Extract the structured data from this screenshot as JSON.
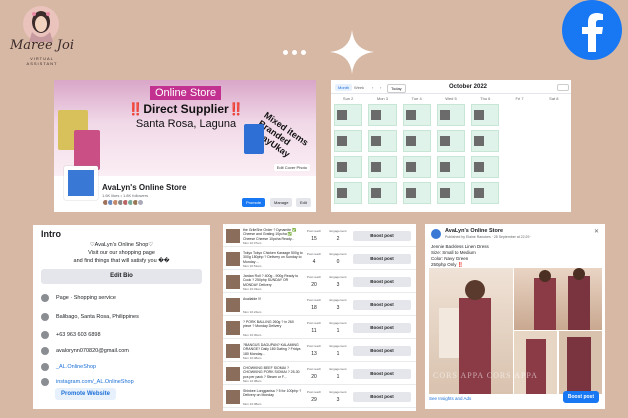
{
  "brand": {
    "name": "Maree Joi",
    "subtitle": "VIRTUAL ASSISTANT"
  },
  "colors": {
    "background": "#d7b8a4",
    "facebook_blue": "#1877f2",
    "online_store_pink": "#c2318f"
  },
  "icons": {
    "facebook": "facebook-logo-icon",
    "sparkle": "sparkle-star-icon"
  },
  "cover_panel": {
    "badge": "Online Store",
    "line1": "‼️Direct Supplier‼️",
    "line2": "Santa Rosa, Laguna",
    "mixed": "Mixed items Branded UkayUkay",
    "edit_cover": "Edit Cover Photo",
    "page_name": "AvaLyn's Online Store",
    "page_meta": "1.6K likes • 1.8K followers",
    "promote": "Promote",
    "manage": "Manage",
    "edit": "Edit"
  },
  "calendar_panel": {
    "tab_active": "Month",
    "tab_other": "Week",
    "today": "Today",
    "title": "October 2022",
    "days": [
      "Sun 2",
      "Mon 3",
      "Tue 4",
      "Wed 5",
      "Thu 6",
      "Fri 7",
      "Sat 8"
    ]
  },
  "intro_panel": {
    "title": "Intro",
    "bio_line1": "♡AvaLyn's Online Shop♡",
    "bio_line2": "Visit our our shopping page",
    "bio_line3": "and find things that will satisfy you ��",
    "edit_bio": "Edit Bio",
    "rows": [
      {
        "label": "Page · Shopping service",
        "link": false
      },
      {
        "label": "Balibago, Santa Rosa, Philippines",
        "link": false
      },
      {
        "label": "+63 963 603 6898",
        "link": false
      },
      {
        "label": "avalorynn070820@gmail.com",
        "link": false
      },
      {
        "label": "_AL.OnlineShop",
        "link": true
      },
      {
        "label": "instagram.com/_AL.OnlineShop",
        "link": true
      }
    ],
    "promote_website": "Promote Website"
  },
  "posts_panel": {
    "col_reach": "Post reach",
    "col_engagement": "Engagement",
    "boost_label": "Boost post",
    "posts": [
      {
        "text": "the GrileShe Order ? Dynamite ✅ Cheese and Grating 10pcha ✅ Cheese Cheese 10pcha Ready...",
        "date": "Mon 10:37am",
        "reach": "15",
        "engagement": "2"
      },
      {
        "text": "Tokyo Tokyo Chicken Karaage 500g to 300g 180php ? Delivery on Sunday to Monday ...",
        "date": "Mon 10:51am",
        "reach": "4",
        "engagement": "0"
      },
      {
        "text": "Jardan Roll ? 400g - 900g Ready to Cook ? 250php SUNDAY OR MONDAY Delivery",
        "date": "Mon 10:43am",
        "reach": "20",
        "engagement": "3"
      },
      {
        "text": "Available !!!",
        "date": "Mon 10:24am",
        "reach": "18",
        "engagement": "3"
      },
      {
        "text": "? PORK BALLING 260g ? in 260 piece ? Monday Delivery",
        "date": "Mon 10:30am",
        "reach": "11",
        "engagement": "1"
      },
      {
        "text": "?BANGUS DAGUPAN? KALAMING ORANGE? Daily 180 Dating ? Fridya 180 Monday...",
        "date": "Mon 10:48am",
        "reach": "13",
        "engagement": "1"
      },
      {
        "text": "CHOWKING BEEF SIOMAI ? CHOWKING PORK SIOMAI ? 25-30 pcs per pack ? Steam or F...",
        "date": "Mon 10:38am",
        "reach": "20",
        "engagement": "1"
      },
      {
        "text": "Shinkee Longganisa ? 5 for 100php ? Delivery on Monday",
        "date": "Mon 10:38am",
        "reach": "29",
        "engagement": "3"
      }
    ]
  },
  "dress_panel": {
    "name": "AvaLyn's Online Store",
    "meta": "Published by Elaine Ranubes · 28 September at 22:29 · ",
    "text_line1": "Jennie Backless Linen Dress",
    "text_line2": "Size: Small to Medium",
    "text_line3": "Color: Navy Green",
    "text_line4": "250php Only ‼️",
    "watermark": "CORS APPA CORS APPA",
    "insights": "See Insights and Ads",
    "boost": "Boost post"
  }
}
